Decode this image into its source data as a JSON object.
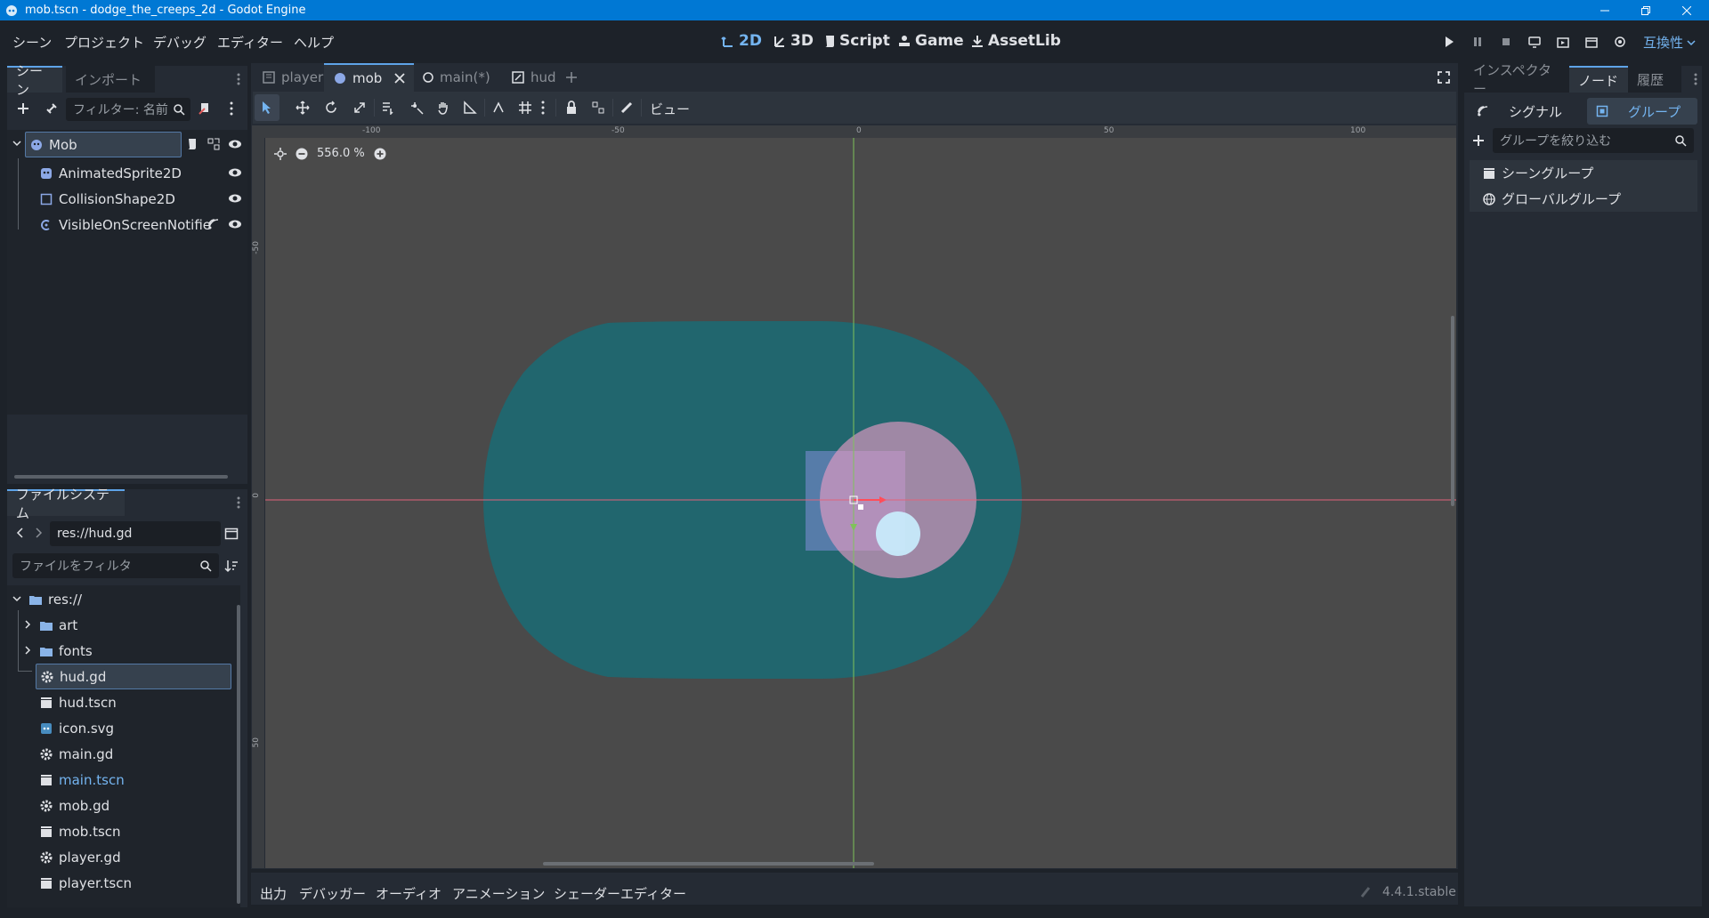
{
  "window": {
    "title": "mob.tscn - dodge_the_creeps_2d - Godot Engine"
  },
  "menu": [
    "シーン",
    "プロジェクト",
    "デバッグ",
    "エディター",
    "ヘルプ"
  ],
  "workspaces": [
    {
      "label": "2D",
      "active": true
    },
    {
      "label": "3D",
      "active": false
    },
    {
      "label": "Script",
      "active": false
    },
    {
      "label": "Game",
      "active": false
    },
    {
      "label": "AssetLib",
      "active": false
    }
  ],
  "renderer": "互換性",
  "scene_dock": {
    "tabs": [
      "シーン",
      "インポート"
    ],
    "filter_placeholder": "フィルター: 名前",
    "nodes": [
      {
        "name": "Mob",
        "icon": "rigidbody-icon"
      },
      {
        "name": "AnimatedSprite2D",
        "icon": "animated-sprite-icon"
      },
      {
        "name": "CollisionShape2D",
        "icon": "collision-shape-icon"
      },
      {
        "name": "VisibleOnScreenNotifie",
        "icon": "notifier-icon"
      }
    ]
  },
  "filesystem": {
    "tab": "ファイルシステム",
    "path": "res://hud.gd",
    "filter_placeholder": "ファイルをフィルタ",
    "items": [
      {
        "name": "res://",
        "type": "folder",
        "level": 0
      },
      {
        "name": "art",
        "type": "folder",
        "level": 1
      },
      {
        "name": "fonts",
        "type": "folder",
        "level": 1
      },
      {
        "name": "hud.gd",
        "type": "script",
        "level": 1
      },
      {
        "name": "hud.tscn",
        "type": "scene",
        "level": 1
      },
      {
        "name": "icon.svg",
        "type": "image",
        "level": 1
      },
      {
        "name": "main.gd",
        "type": "script",
        "level": 1
      },
      {
        "name": "main.tscn",
        "type": "scene",
        "level": 1
      },
      {
        "name": "mob.gd",
        "type": "script",
        "level": 1
      },
      {
        "name": "mob.tscn",
        "type": "scene",
        "level": 1
      },
      {
        "name": "player.gd",
        "type": "script",
        "level": 1
      },
      {
        "name": "player.tscn",
        "type": "scene",
        "level": 1
      }
    ]
  },
  "scene_tabs": [
    {
      "label": "player",
      "active": false
    },
    {
      "label": "mob",
      "active": true
    },
    {
      "label": "main(*)",
      "active": false
    },
    {
      "label": "hud",
      "active": false
    }
  ],
  "toolbar": {
    "view_label": "ビュー"
  },
  "viewport": {
    "zoom": "556.0 %",
    "ruler_labels": [
      "-100",
      "-50",
      "0",
      "50",
      "100"
    ],
    "v_ruler_labels": [
      "-50",
      "0",
      "50"
    ]
  },
  "bottom_tabs": [
    "出力",
    "デバッガー",
    "オーディオ",
    "アニメーション",
    "シェーダーエディター"
  ],
  "version": "4.4.1.stable",
  "right_dock": {
    "tabs": [
      "インスペクター",
      "ノード",
      "履歴"
    ],
    "subtabs": [
      "シグナル",
      "グループ"
    ],
    "filter_placeholder": "グループを絞り込む",
    "groups": [
      "シーングループ",
      "グローバルグループ"
    ]
  }
}
